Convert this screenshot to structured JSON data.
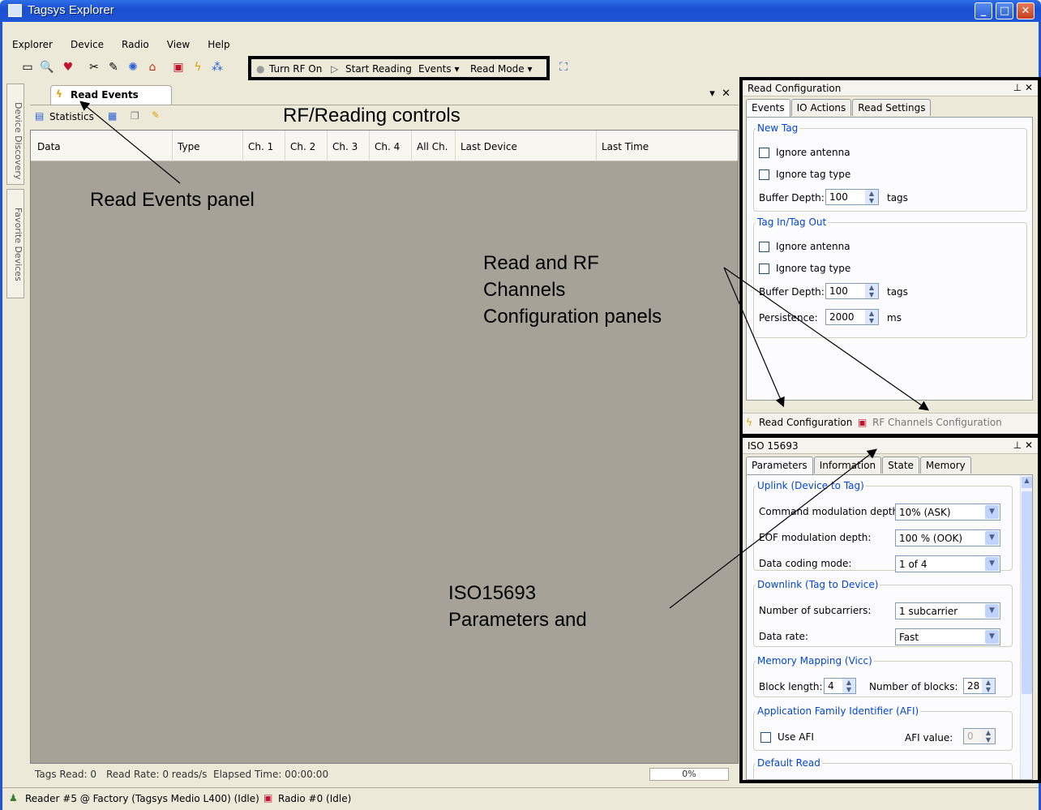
{
  "window": {
    "title": "Tagsys Explorer"
  },
  "menu": [
    "Explorer",
    "Device",
    "Radio",
    "View",
    "Help"
  ],
  "toolbar": {
    "turn_rf_on": "Turn RF On",
    "start_reading": "Start Reading",
    "events": "Events",
    "read_mode": "Read Mode"
  },
  "left_tabs": {
    "device_discovery": "Device Discovery",
    "favorite_devices": "Favorite Devices"
  },
  "read_events": {
    "tab_label": "Read Events",
    "statistics": "Statistics",
    "columns": [
      "Data",
      "Type",
      "Ch. 1",
      "Ch. 2",
      "Ch. 3",
      "Ch. 4",
      "All Ch.",
      "Last Device",
      "Last Time"
    ],
    "status": {
      "tags_read": "Tags Read: 0",
      "read_rate": "Read Rate: 0 reads/s",
      "elapsed": "Elapsed Time: 00:00:00",
      "progress": "0%"
    }
  },
  "read_config": {
    "title": "Read Configuration",
    "tabs": [
      "Events",
      "IO Actions",
      "Read Settings"
    ],
    "new_tag": {
      "legend": "New Tag",
      "ignore_antenna": "Ignore antenna",
      "ignore_tag_type": "Ignore tag type",
      "buffer_label": "Buffer Depth:",
      "buffer_value": "100",
      "buffer_unit": "tags"
    },
    "tag_in_out": {
      "legend": "Tag In/Tag Out",
      "ignore_antenna": "Ignore antenna",
      "ignore_tag_type": "Ignore tag type",
      "buffer_label": "Buffer Depth:",
      "buffer_value": "100",
      "buffer_unit": "tags",
      "persistence_label": "Persistence:",
      "persistence_value": "2000",
      "persistence_unit": "ms"
    },
    "bottom_tabs": {
      "read_config": "Read Configuration",
      "rf_channels": "RF Channels Configuration"
    }
  },
  "iso": {
    "title": "ISO 15693",
    "tabs": [
      "Parameters",
      "Information",
      "State",
      "Memory"
    ],
    "uplink": {
      "legend": "Uplink (Device to Tag)",
      "cmd_label": "Command modulation depth:",
      "cmd_value": "10% (ASK)",
      "eof_label": "EOF modulation depth:",
      "eof_value": "100 % (OOK)",
      "coding_label": "Data coding mode:",
      "coding_value": "1 of 4"
    },
    "downlink": {
      "legend": "Downlink (Tag to Device)",
      "subc_label": "Number of subcarriers:",
      "subc_value": "1 subcarrier",
      "rate_label": "Data rate:",
      "rate_value": "Fast"
    },
    "memory": {
      "legend": "Memory Mapping (Vicc)",
      "block_label": "Block length:",
      "block_value": "4",
      "nblocks_label": "Number of blocks:",
      "nblocks_value": "28"
    },
    "afi": {
      "legend": "Application Family Identifier (AFI)",
      "use_afi": "Use AFI",
      "afi_value_label": "AFI value:",
      "afi_value": "0"
    },
    "default_read": {
      "legend": "Default Read"
    }
  },
  "statusbar": {
    "reader": "Reader #5 @ Factory (Tagsys Medio L400) (Idle)",
    "radio": "Radio #0 (Idle)"
  },
  "annotations": {
    "rf_controls": "RF/Reading controls",
    "read_events_panel": "Read Events panel",
    "config_panels": [
      "Read and RF",
      "Channels",
      "Configuration panels"
    ],
    "iso_params": [
      "ISO15693",
      "Parameters and"
    ]
  }
}
